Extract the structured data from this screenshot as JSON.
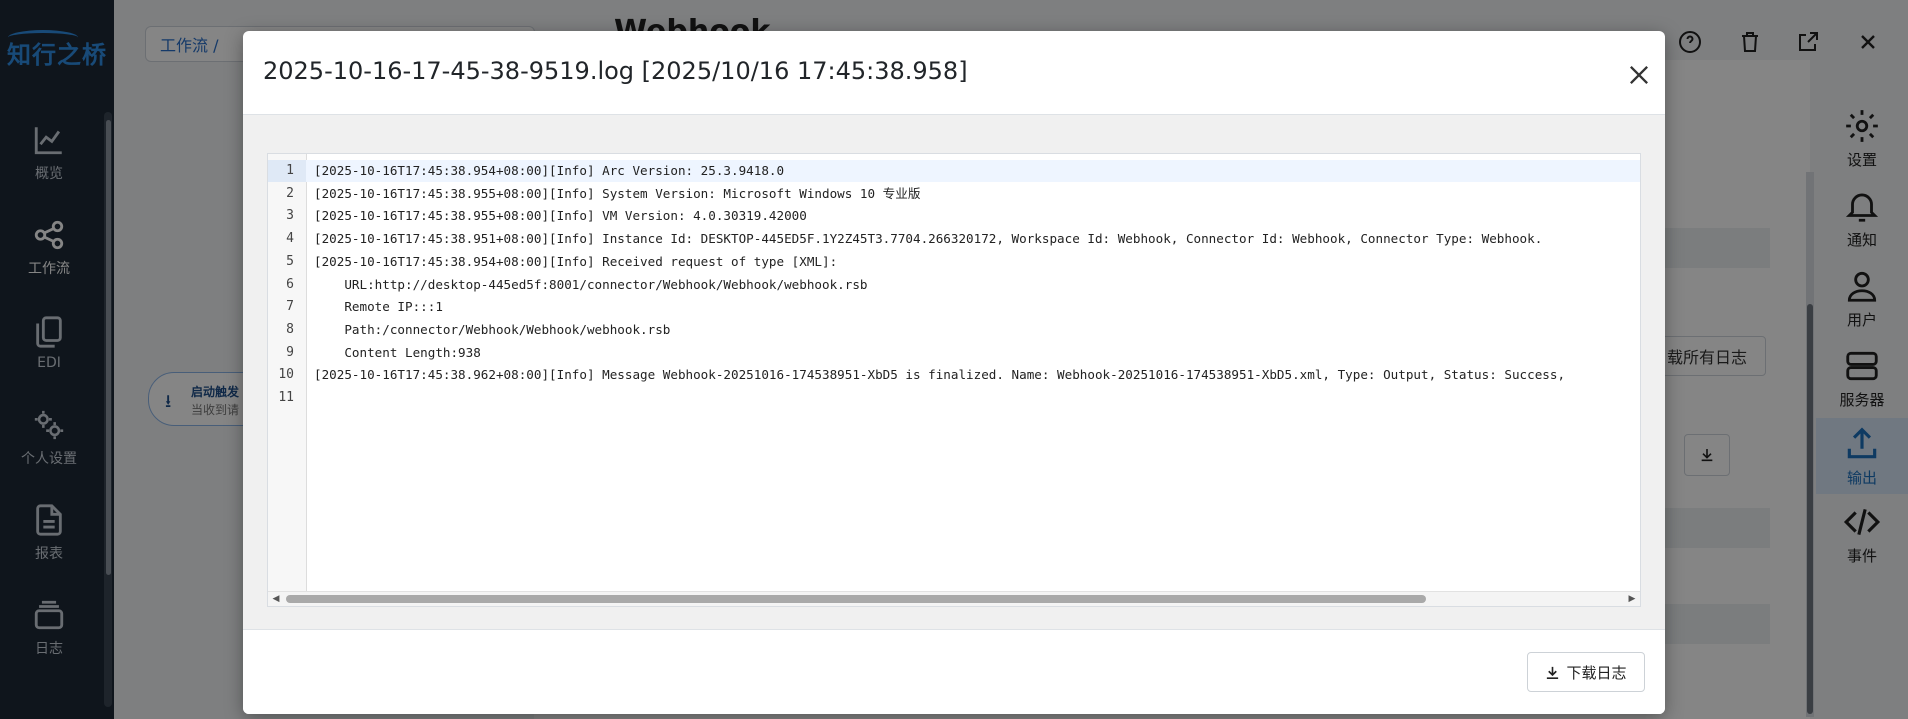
{
  "app": {
    "logo_text": "知行之桥",
    "colors": {
      "sidebar_bg": "#1e2937",
      "accent": "#2f8fe6",
      "active_nav": "#d7e7f7"
    }
  },
  "left_nav": [
    {
      "label": "概览",
      "icon": "chart-line-icon"
    },
    {
      "label": "工作流",
      "icon": "share-nodes-icon"
    },
    {
      "label": "EDI",
      "icon": "copy-icon"
    },
    {
      "label": "个人设置",
      "icon": "gears-icon"
    },
    {
      "label": "报表",
      "icon": "file-text-icon"
    },
    {
      "label": "日志",
      "icon": "layers-icon"
    }
  ],
  "background": {
    "breadcrumb": "工作流  /",
    "title": "Webhook",
    "trigger": {
      "line1": "启动触发",
      "line2": "当收到请"
    },
    "download_all_label": "载所有日志"
  },
  "right_nav": [
    {
      "label": "设置",
      "icon": "gear-icon"
    },
    {
      "label": "通知",
      "icon": "bell-icon"
    },
    {
      "label": "用户",
      "icon": "user-icon"
    },
    {
      "label": "服务器",
      "icon": "server-icon"
    },
    {
      "label": "输出",
      "icon": "upload-icon",
      "active": true
    },
    {
      "label": "事件",
      "icon": "code-icon"
    }
  ],
  "modal": {
    "title": "2025-10-16-17-45-38-9519.log [2025/10/16 17:45:38.958]",
    "download_label": "下载日志",
    "lines": [
      {
        "num": "1",
        "text": "[2025-10-16T17:45:38.954+08:00][Info] Arc Version: 25.3.9418.0"
      },
      {
        "num": "2",
        "text": "[2025-10-16T17:45:38.955+08:00][Info] System Version: Microsoft Windows 10 专业版"
      },
      {
        "num": "3",
        "text": "[2025-10-16T17:45:38.955+08:00][Info] VM Version: 4.0.30319.42000"
      },
      {
        "num": "4",
        "text": "[2025-10-16T17:45:38.951+08:00][Info] Instance Id: DESKTOP-445ED5F.1Y2Z45T3.7704.266320172, Workspace Id: Webhook, Connector Id: Webhook, Connector Type: Webhook."
      },
      {
        "num": "5",
        "text": "[2025-10-16T17:45:38.954+08:00][Info] Received request of type [XML]:"
      },
      {
        "num": "6",
        "text": "    URL:http://desktop-445ed5f:8001/connector/Webhook/Webhook/webhook.rsb"
      },
      {
        "num": "7",
        "text": "    Remote IP:::1"
      },
      {
        "num": "8",
        "text": "    Path:/connector/Webhook/Webhook/webhook.rsb"
      },
      {
        "num": "9",
        "text": "    Content Length:938"
      },
      {
        "num": "10",
        "text": "[2025-10-16T17:45:38.962+08:00][Info] Message Webhook-20251016-174538951-XbD5 is finalized. Name: Webhook-20251016-174538951-XbD5.xml, Type: Output, Status: Success,"
      },
      {
        "num": "11",
        "text": ""
      }
    ]
  }
}
